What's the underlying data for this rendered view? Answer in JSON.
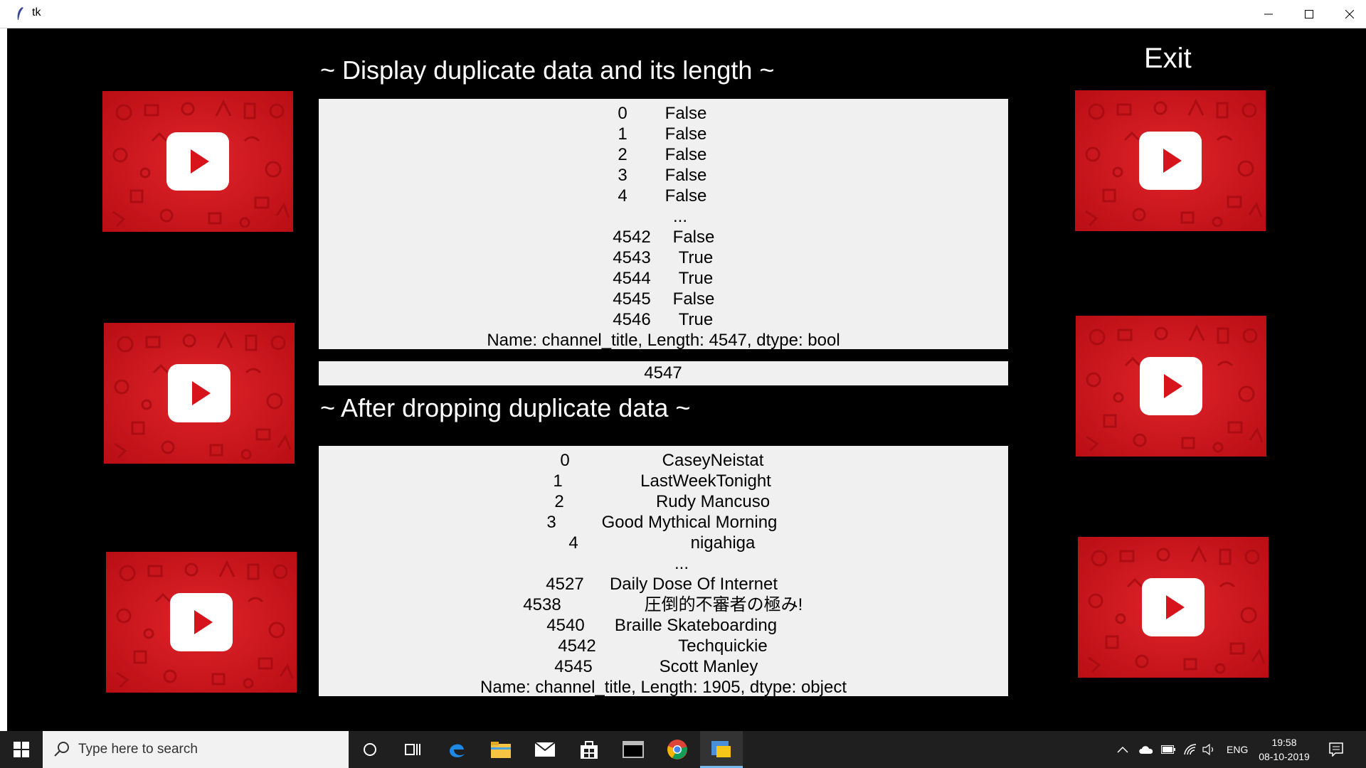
{
  "window": {
    "title": "tk"
  },
  "headings": {
    "duplicate": "~ Display duplicate data and its length ~",
    "dropped": "~ After dropping duplicate data ~",
    "exit": "Exit"
  },
  "duplicate_panel": {
    "rows": [
      {
        "index": "0",
        "value": "False"
      },
      {
        "index": "1",
        "value": "False"
      },
      {
        "index": "2",
        "value": "False"
      },
      {
        "index": "3",
        "value": "False"
      },
      {
        "index": "4",
        "value": "False"
      },
      {
        "index": "",
        "value": "..."
      },
      {
        "index": "4542",
        "value": "False"
      },
      {
        "index": "4543",
        "value": "True"
      },
      {
        "index": "4544",
        "value": "True"
      },
      {
        "index": "4545",
        "value": "False"
      },
      {
        "index": "4546",
        "value": "True"
      }
    ],
    "footer": "Name: channel_title, Length: 4547, dtype: bool"
  },
  "length_box": {
    "value": "4547"
  },
  "dropped_panel": {
    "rows": [
      {
        "index": "0",
        "value": "CaseyNeistat"
      },
      {
        "index": "1",
        "value": "LastWeekTonight"
      },
      {
        "index": "2",
        "value": "Rudy Mancuso"
      },
      {
        "index": "3",
        "value": "Good Mythical Morning"
      },
      {
        "index": "4",
        "value": "nigahiga"
      },
      {
        "index": "",
        "value": "..."
      },
      {
        "index": "4527",
        "value": "Daily Dose Of Internet"
      },
      {
        "index": "4538",
        "value": "圧倒的不審者の極み!"
      },
      {
        "index": "4540",
        "value": "Braille Skateboarding"
      },
      {
        "index": "4542",
        "value": "Techquickie"
      },
      {
        "index": "4545",
        "value": "Scott Manley"
      }
    ],
    "footer": "Name: channel_title, Length: 1905, dtype: object"
  },
  "taskbar": {
    "search_placeholder": "Type here to search",
    "language": "ENG",
    "time": "19:58",
    "date": "08-10-2019"
  },
  "colors": {
    "youtube_red": "#d7141c",
    "play_white": "#ffffff"
  }
}
